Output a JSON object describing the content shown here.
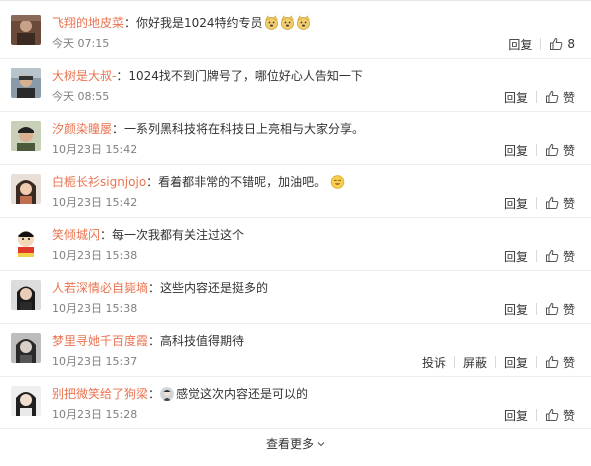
{
  "comments": [
    {
      "username": "飞翔的地皮菜",
      "text": "：你好我是1024特约专员",
      "time": "今天 07:15",
      "reply_label": "回复",
      "like_label": "8",
      "avatar_color": "#7a5a4a",
      "emoji_count": 3
    },
    {
      "username": "大树是大叔-",
      "text": "：1024找不到门牌号了，哪位好心人告知一下",
      "time": "今天 08:55",
      "reply_label": "回复",
      "like_label": "赞",
      "avatar_color": "#5a6a7a"
    },
    {
      "username": "汐颜染瞳屡",
      "text": "：一系列黑科技将在科技日上亮相与大家分享。",
      "time": "10月23日 15:42",
      "reply_label": "回复",
      "like_label": "赞",
      "avatar_color": "#4a5a3a"
    },
    {
      "username": "白栀长衫signjojo",
      "text": "：看着都非常的不错呢，加油吧。",
      "time": "10月23日 15:42",
      "reply_label": "回复",
      "like_label": "赞",
      "avatar_color": "#c89a7a"
    },
    {
      "username": "笑倾城闪",
      "text": "：每一次我都有关注过这个",
      "time": "10月23日 15:38",
      "reply_label": "回复",
      "like_label": "赞",
      "avatar_color": "#e8c040"
    },
    {
      "username": "人若深情必自毙墒",
      "text": "：这些内容还是挺多的",
      "time": "10月23日 15:38",
      "reply_label": "回复",
      "like_label": "赞",
      "avatar_color": "#303030"
    },
    {
      "username": "梦里寻她千百度霞",
      "text": "：高科技值得期待",
      "time": "10月23日 15:37",
      "report_label": "投诉",
      "block_label": "屏蔽",
      "reply_label": "回复",
      "like_label": "赞",
      "avatar_color": "#404040"
    },
    {
      "username": "别把微笑给了狗梁",
      "text": "感觉这次内容还是可以的",
      "text_prefix": "：",
      "time": "10月23日 15:28",
      "reply_label": "回复",
      "like_label": "赞",
      "avatar_color": "#3a3a3a"
    }
  ],
  "footer": {
    "more_label": "查看更多"
  },
  "colors": {
    "username": "#eb7350",
    "time": "#808080",
    "text": "#333333"
  }
}
